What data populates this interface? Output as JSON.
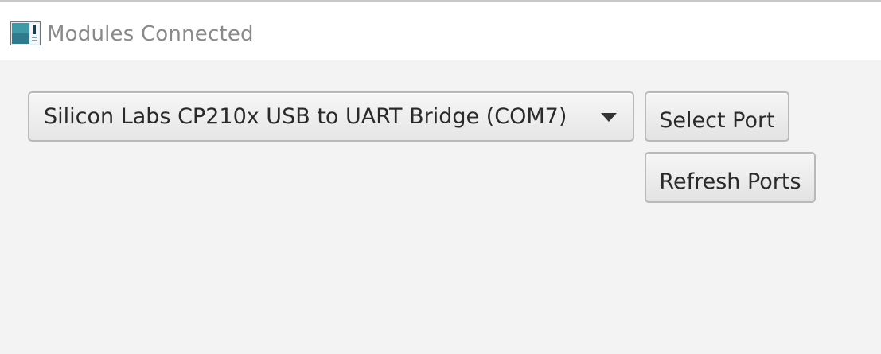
{
  "window": {
    "title": "Modules Connected",
    "icon": "app-window-icon"
  },
  "port_selector": {
    "selected_value": "Silicon Labs CP210x USB to UART Bridge (COM7)",
    "arrow_icon": "chevron-down-icon"
  },
  "buttons": {
    "select_port_label": "Select Port",
    "refresh_ports_label": "Refresh Ports"
  }
}
